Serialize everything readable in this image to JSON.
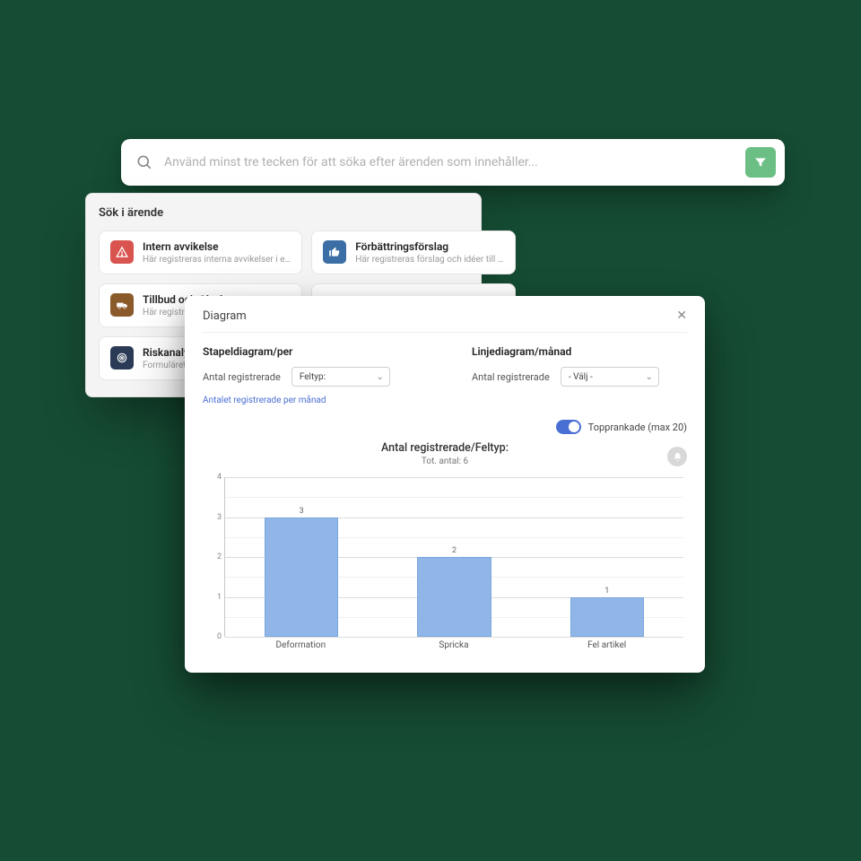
{
  "search": {
    "placeholder": "Använd minst tre tecken för att söka efter ärenden som innehåller..."
  },
  "panel": {
    "title": "Sök i ärende",
    "items": [
      {
        "title": "Intern avvikelse",
        "desc": "Här registreras interna avvikelser i e…"
      },
      {
        "title": "Förbättringsförslag",
        "desc": "Här registreras förslag och idéer till …"
      },
      {
        "title": "Tillbud och Olycka",
        "desc": "Här registreras…"
      },
      {
        "title": "",
        "desc": ""
      },
      {
        "title": "Riskanalys - L…",
        "desc": "Formuläret syft…"
      }
    ]
  },
  "modal": {
    "title": "Diagram",
    "bar_section": "Stapeldiagram/per",
    "line_section": "Linjediagram/månad",
    "count_label": "Antal registrerade",
    "select_feltyp": "Feltyp:",
    "select_valj": "- Välj -",
    "link": "Antalet registrerade per månad",
    "toprank": "Topprankade (max 20)"
  },
  "chart_data": {
    "type": "bar",
    "title": "Antal registrerade/Feltyp:",
    "subtitle": "Tot. antal: 6",
    "ylabel": "",
    "xlabel": "",
    "ylim": [
      0,
      4
    ],
    "categories": [
      "Deformation",
      "Spricka",
      "Fel artikel"
    ],
    "values": [
      3,
      2,
      1
    ]
  }
}
